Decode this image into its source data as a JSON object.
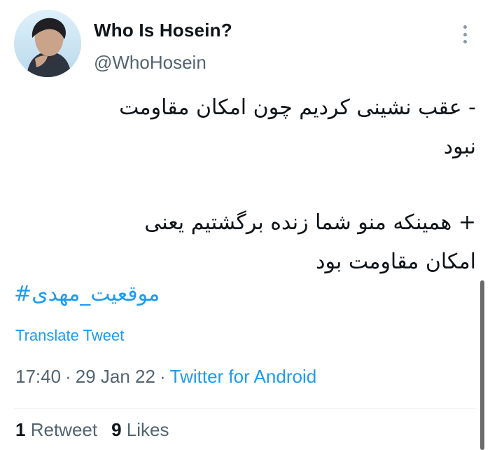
{
  "author": {
    "display_name": "Who Is Hosein?",
    "handle": "@WhoHosein"
  },
  "menu": {
    "icon": "more-vertical-icon"
  },
  "tweet": {
    "lines": [
      "- عقب نشینی کردیم چون امکان مقاومت",
      "نبود",
      "+ همینکه منو شما زنده برگشتیم یعنی",
      "امکان مقاومت بود"
    ],
    "hashtag": "#موقعیت_مهدی"
  },
  "translate_label": "Translate Tweet",
  "meta": {
    "time": "17:40",
    "separator": "·",
    "date": "29 Jan 22",
    "source": "Twitter for Android"
  },
  "stats": {
    "retweets_count": "1",
    "retweets_label": "Retweet",
    "likes_count": "9",
    "likes_label": "Likes"
  },
  "colors": {
    "accent": "#1d9bf0",
    "text": "#0f1419",
    "secondary": "#536471"
  }
}
